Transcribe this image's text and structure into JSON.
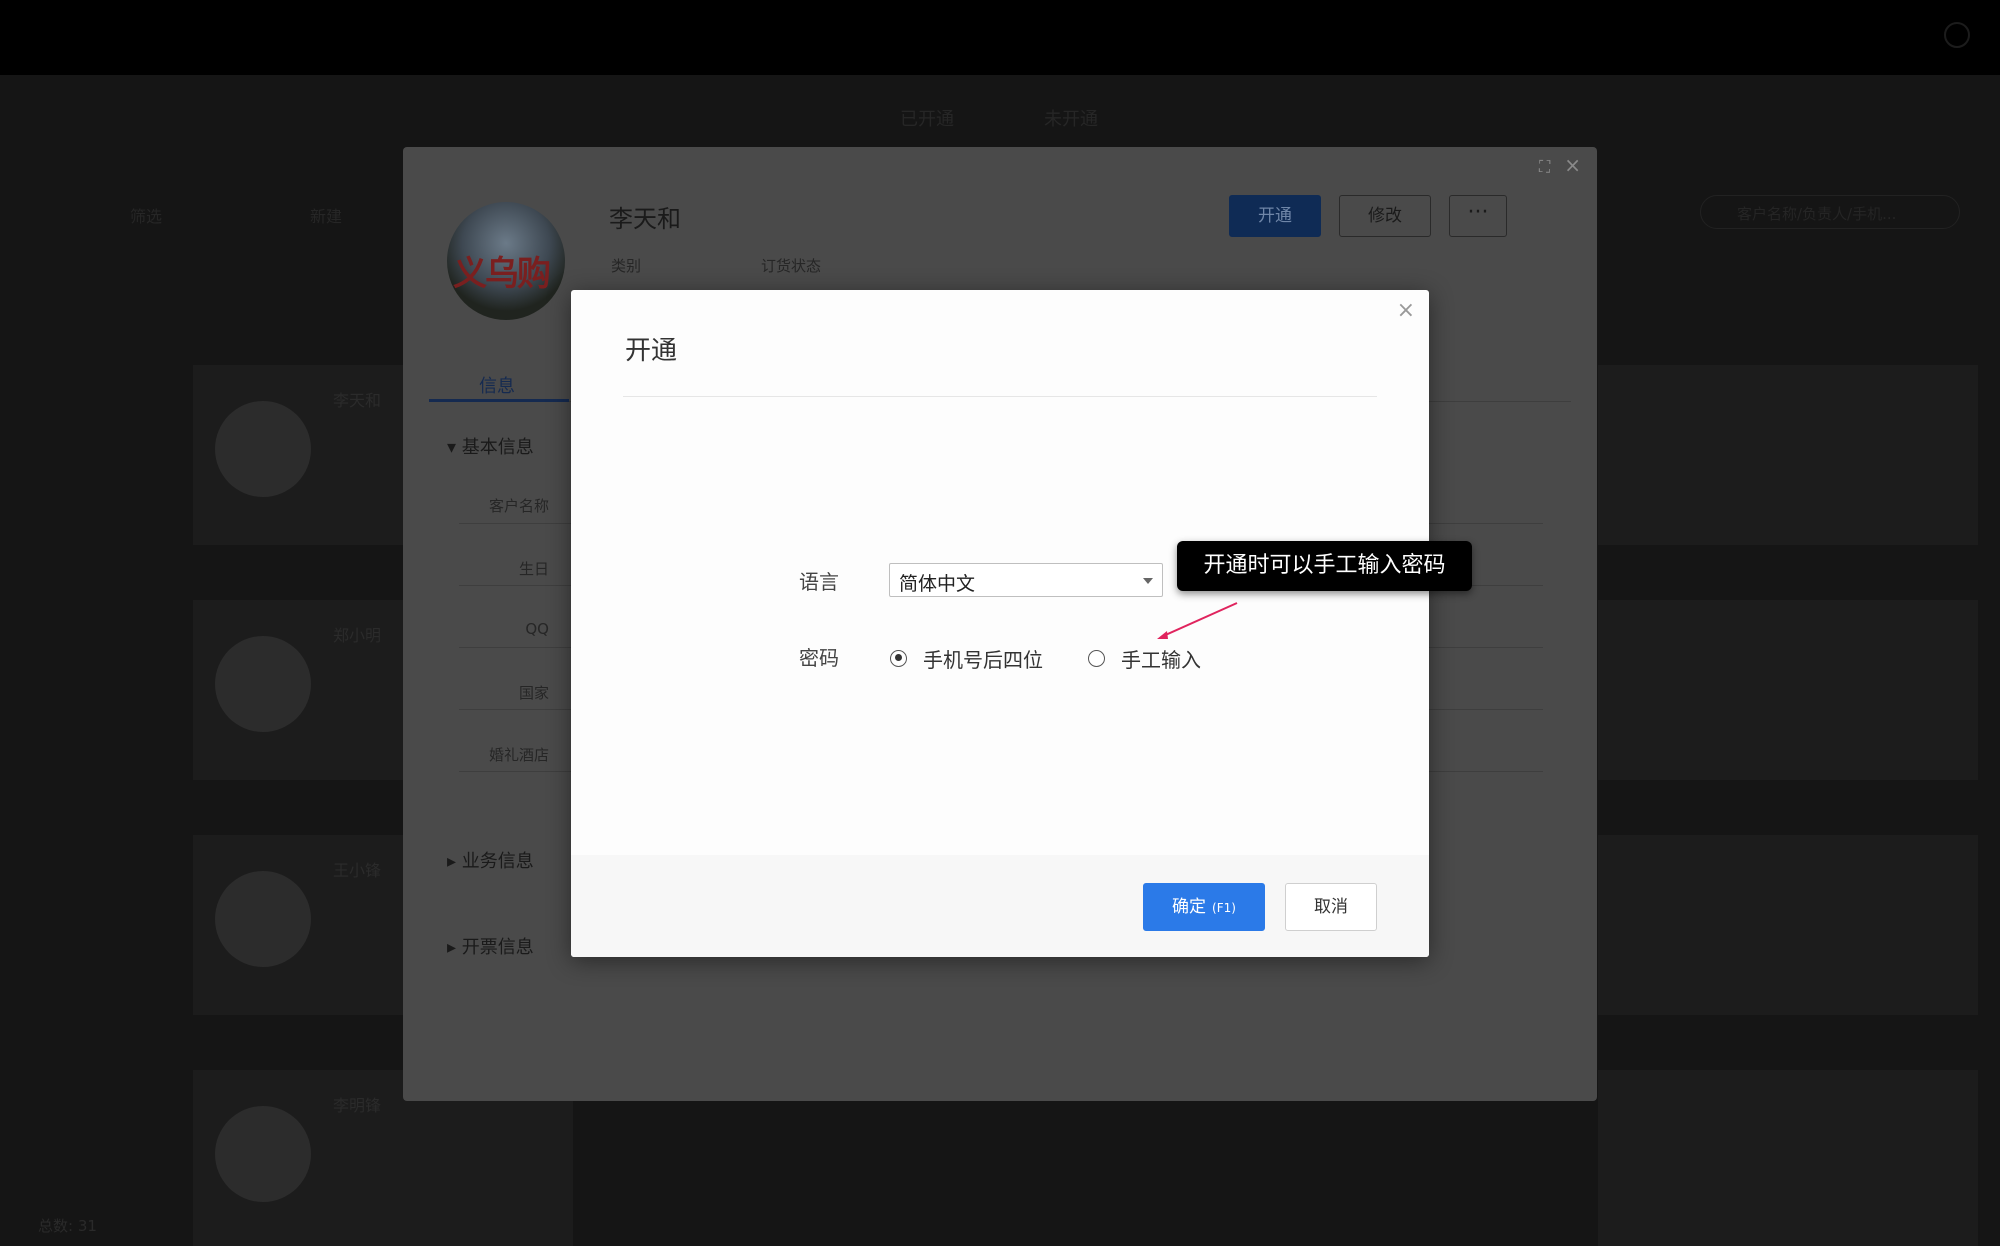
{
  "base_page": {
    "tabs": [
      "已开通",
      "未开通"
    ],
    "toolbar": [
      "筛选",
      "新建"
    ],
    "search_placeholder": "客户名称/负责人/手机...",
    "cards": [
      "李天和",
      "郑小明",
      "王小锋",
      "李明锋"
    ],
    "footer": "总数: 31"
  },
  "detail_panel": {
    "customer_name": "李天和",
    "meta_labels": [
      "类别",
      "订货状态"
    ],
    "avatar_text": "义乌购",
    "buttons": {
      "open": "开通",
      "edit": "修改",
      "more": "···"
    },
    "tab_info": "信息",
    "sections": {
      "basic": "基本信息",
      "business": "业务信息",
      "invoice": "开票信息"
    },
    "fields": [
      "客户名称",
      "生日",
      "QQ",
      "国家",
      "婚礼酒店"
    ]
  },
  "modal": {
    "title": "开通",
    "close": "×",
    "language_label": "语言",
    "language_value": "简体中文",
    "password_label": "密码",
    "password_options": [
      {
        "label": "手机号后四位",
        "checked": true
      },
      {
        "label": "手工输入",
        "checked": false
      }
    ],
    "tooltip": "开通时可以手工输入密码",
    "ok_label": "确定",
    "ok_hotkey": "(F1)",
    "cancel_label": "取消"
  },
  "colors": {
    "primary": "#2b7ae8",
    "overlay": "#4a4a4a",
    "tooltip_bg": "#000000",
    "arrow": "#e0245e"
  }
}
